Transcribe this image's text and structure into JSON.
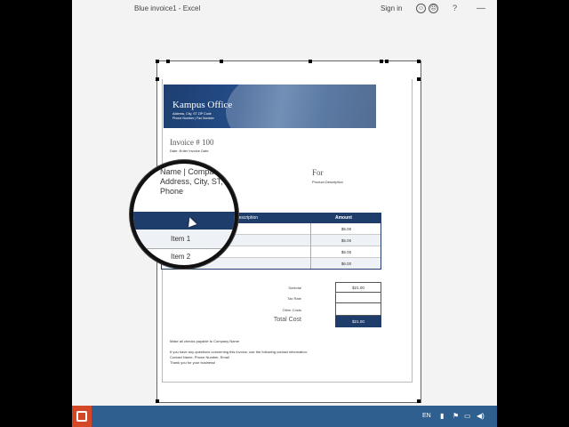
{
  "window": {
    "title": "Blue invoice1 - Excel",
    "sign_in": "Sign in",
    "help": "?",
    "minimize": "—"
  },
  "invoice": {
    "company": "Kampus Office",
    "company_address": "Address, City, ST ZIP Code",
    "company_phone": "Phone Number | Fax Number",
    "title": "Invoice # 100",
    "date": "Date: Enter Invoice Date",
    "bill_to_name": "Name | Company",
    "bill_to_address": "Address, City, ST, ZIP",
    "bill_to_phone": "Phone",
    "for_label": "For",
    "for_description": "Product Description",
    "table": {
      "headers": [
        "Description",
        "Amount"
      ],
      "rows": [
        {
          "description": "Item 1",
          "amount": "$5.00"
        },
        {
          "description": "Item 2",
          "amount": "$5.00"
        },
        {
          "description": "",
          "amount": "$5.00"
        },
        {
          "description": "",
          "amount": "$6.00"
        }
      ]
    },
    "summary": {
      "subtotal_label": "Subtotal",
      "subtotal_value": "$21.00",
      "tax_label": "Tax Rate",
      "tax_value": "",
      "other_label": "Other Costs",
      "other_value": "",
      "total_label": "Total Cost",
      "total_value": "$21.00"
    },
    "footer": {
      "payable": "Make all checks payable to Company Name",
      "questions": "If you have any questions concerning this invoice, use the following contact information:",
      "contact": "Contact Name, Phone Number, Email",
      "thanks": "Thank you for your business!"
    }
  },
  "magnifier": {
    "name": "Name | Compa",
    "address": "Address, City, ST, Zi",
    "phone": "Phone",
    "item1": "Item 1",
    "item2": "Item 2"
  },
  "taskbar": {
    "language": "EN"
  },
  "colors": {
    "accent": "#1f3d6b",
    "taskbar": "#2e5f8e",
    "app_icon": "#d24726"
  }
}
